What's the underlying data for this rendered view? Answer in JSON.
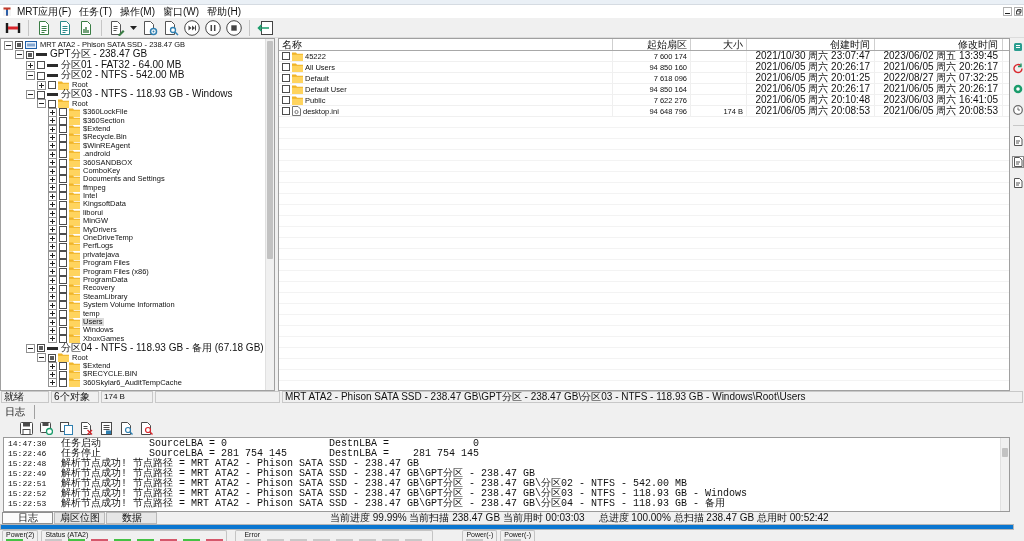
{
  "menu_bar": {
    "items": [
      "MRT应用(F)",
      "任务(T)",
      "操作(M)",
      "窗口(W)",
      "帮助(H)"
    ]
  },
  "tree": {
    "items": [
      {
        "label": "MRT ATA2 - Phison SATA SSD - 238.47 GB",
        "kind": "disk",
        "expanded": true,
        "partial": true,
        "selected": false,
        "children": [
          {
            "label": "GPT分区 - 238.47 GB",
            "kind": "partition",
            "expanded": true,
            "partial": true,
            "selected": false,
            "children": [
              {
                "label": "分区01 - FAT32 - 64.00 MB",
                "kind": "partition",
                "expanded": false,
                "partial": false,
                "selected": false
              },
              {
                "label": "分区02 - NTFS - 542.00 MB",
                "kind": "partition",
                "expanded": true,
                "partial": false,
                "selected": false,
                "children": [
                  {
                    "label": "Root",
                    "kind": "folder",
                    "expanded": false,
                    "partial": false,
                    "selected": false
                  }
                ]
              },
              {
                "label": "分区03 - NTFS - 118.93 GB - Windows",
                "kind": "partition",
                "expanded": true,
                "partial": false,
                "selected": false,
                "children": [
                  {
                    "label": "Root",
                    "kind": "folder",
                    "expanded": true,
                    "partial": false,
                    "selected": false,
                    "children": [
                      {
                        "label": "$360LockFile",
                        "kind": "folder",
                        "expanded": false,
                        "partial": false,
                        "selected": false
                      },
                      {
                        "label": "$360Section",
                        "kind": "folder",
                        "expanded": false,
                        "partial": false,
                        "selected": false
                      },
                      {
                        "label": "$Extend",
                        "kind": "folder",
                        "expanded": false,
                        "partial": false,
                        "selected": false
                      },
                      {
                        "label": "$Recycle.Bin",
                        "kind": "folder",
                        "expanded": false,
                        "partial": false,
                        "selected": false
                      },
                      {
                        "label": "$WinREAgent",
                        "kind": "folder",
                        "expanded": false,
                        "partial": false,
                        "selected": false
                      },
                      {
                        "label": ".android",
                        "kind": "folder",
                        "expanded": false,
                        "partial": false,
                        "selected": false
                      },
                      {
                        "label": "360SANDBOX",
                        "kind": "folder",
                        "expanded": false,
                        "partial": false,
                        "selected": false
                      },
                      {
                        "label": "ComboKey",
                        "kind": "folder",
                        "expanded": false,
                        "partial": false,
                        "selected": false
                      },
                      {
                        "label": "Documents and Settings",
                        "kind": "folder",
                        "expanded": false,
                        "partial": false,
                        "selected": false
                      },
                      {
                        "label": "ffmpeg",
                        "kind": "folder",
                        "expanded": false,
                        "partial": false,
                        "selected": false
                      },
                      {
                        "label": "Intel",
                        "kind": "folder",
                        "expanded": false,
                        "partial": false,
                        "selected": false
                      },
                      {
                        "label": "KingsoftData",
                        "kind": "folder",
                        "expanded": false,
                        "partial": false,
                        "selected": false
                      },
                      {
                        "label": "liborui",
                        "kind": "folder",
                        "expanded": false,
                        "partial": false,
                        "selected": false
                      },
                      {
                        "label": "MinGW",
                        "kind": "folder",
                        "expanded": false,
                        "partial": false,
                        "selected": false
                      },
                      {
                        "label": "MyDrivers",
                        "kind": "folder",
                        "expanded": false,
                        "partial": false,
                        "selected": false
                      },
                      {
                        "label": "OneDriveTemp",
                        "kind": "folder",
                        "expanded": false,
                        "partial": false,
                        "selected": false
                      },
                      {
                        "label": "PerfLogs",
                        "kind": "folder",
                        "expanded": false,
                        "partial": false,
                        "selected": false
                      },
                      {
                        "label": "privatejava",
                        "kind": "folder",
                        "expanded": false,
                        "partial": false,
                        "selected": false
                      },
                      {
                        "label": "Program Files",
                        "kind": "folder",
                        "expanded": false,
                        "partial": false,
                        "selected": false
                      },
                      {
                        "label": "Program Files (x86)",
                        "kind": "folder",
                        "expanded": false,
                        "partial": false,
                        "selected": false
                      },
                      {
                        "label": "ProgramData",
                        "kind": "folder",
                        "expanded": false,
                        "partial": false,
                        "selected": false
                      },
                      {
                        "label": "Recovery",
                        "kind": "folder",
                        "expanded": false,
                        "partial": false,
                        "selected": false
                      },
                      {
                        "label": "SteamLibrary",
                        "kind": "folder",
                        "expanded": false,
                        "partial": false,
                        "selected": false
                      },
                      {
                        "label": "System Volume Information",
                        "kind": "folder",
                        "expanded": false,
                        "partial": false,
                        "selected": false
                      },
                      {
                        "label": "temp",
                        "kind": "folder",
                        "expanded": false,
                        "partial": false,
                        "selected": false
                      },
                      {
                        "label": "Users",
                        "kind": "folder",
                        "expanded": false,
                        "partial": false,
                        "selected": true
                      },
                      {
                        "label": "Windows",
                        "kind": "folder",
                        "expanded": false,
                        "partial": false,
                        "selected": false
                      },
                      {
                        "label": "XboxGames",
                        "kind": "folder",
                        "expanded": false,
                        "partial": false,
                        "selected": false
                      }
                    ]
                  }
                ]
              },
              {
                "label": "分区04 - NTFS - 118.93 GB - 备用 (67.18 GB)",
                "kind": "partition",
                "expanded": true,
                "partial": true,
                "selected": false,
                "children": [
                  {
                    "label": "Root",
                    "kind": "folder",
                    "expanded": true,
                    "partial": true,
                    "selected": false,
                    "children": [
                      {
                        "label": "$Extend",
                        "kind": "folder",
                        "expanded": false,
                        "partial": false,
                        "selected": false
                      },
                      {
                        "label": "$RECYCLE.BIN",
                        "kind": "folder",
                        "expanded": false,
                        "partial": false,
                        "selected": false
                      },
                      {
                        "label": "360Skylar6_AuditTempCache",
                        "kind": "folder",
                        "expanded": false,
                        "partial": false,
                        "selected": false
                      }
                    ]
                  }
                ]
              }
            ]
          }
        ]
      }
    ]
  },
  "file_list": {
    "columns": [
      "名称",
      "起始扇区",
      "大小",
      "创建时间",
      "修改时间"
    ],
    "rows": [
      {
        "name": "45222",
        "kind": "folder",
        "checked": false,
        "selected": false,
        "start_sector": "7 600 174",
        "created": "2021/10/30 周六 23:07:47",
        "modified": "2023/06/02 周五 13:39:45"
      },
      {
        "name": "All Users",
        "kind": "folder",
        "checked": false,
        "selected": false,
        "start_sector": "94 850 160",
        "created": "2021/06/05 周六 20:26:17",
        "modified": "2021/06/05 周六 20:26:17"
      },
      {
        "name": "Default",
        "kind": "folder",
        "checked": false,
        "selected": false,
        "start_sector": "7 618 096",
        "created": "2021/06/05 周六 20:01:25",
        "modified": "2022/08/27 周六 07:32:25"
      },
      {
        "name": "Default User",
        "kind": "folder",
        "checked": false,
        "selected": false,
        "start_sector": "94 850 164",
        "created": "2021/06/05 周六 20:26:17",
        "modified": "2021/06/05 周六 20:26:17"
      },
      {
        "name": "Public",
        "kind": "folder",
        "checked": false,
        "selected": false,
        "start_sector": "7 622 276",
        "created": "2021/06/05 周六 20:10:48",
        "modified": "2023/06/03 周六 16:41:05"
      },
      {
        "name": "desktop.ini",
        "kind": "file",
        "checked": false,
        "selected": false,
        "start_sector": "94 648 796",
        "size": "174 B",
        "created": "2021/06/05 周六 20:08:53",
        "modified": "2021/06/05 周六 20:08:53"
      }
    ]
  },
  "side_toolbar": {
    "items": [
      {
        "kind": "tile",
        "selected": false
      },
      {
        "kind": "arrows",
        "selected": false
      },
      {
        "kind": "circle",
        "selected": false
      },
      {
        "kind": "clock",
        "selected": false
      },
      {
        "kind": "document",
        "selected": false
      },
      {
        "kind": "document",
        "selected": true
      },
      {
        "kind": "document",
        "selected": false
      }
    ]
  },
  "status_bar": {
    "state": "就绪",
    "object_count": "6个对象",
    "size": "174 B",
    "path": "MRT ATA2 - Phison SATA SSD - 238.47 GB\\GPT分区 - 238.47 GB\\分区03 - NTFS - 118.93 GB - Windows\\Root\\Users"
  },
  "log_panel": {
    "title": "日志",
    "entries": [
      {
        "time": "14:47:30",
        "message": "任务启动        SourceLBA = 0                 DestnLBA =              0"
      },
      {
        "time": "15:22:46",
        "message": "任务停止        SourceLBA = 281 754 145       DestnLBA =    281 754 145"
      },
      {
        "time": "15:22:48",
        "message": "解析节点成功! 节点路径 = MRT ATA2 - Phison SATA SSD - 238.47 GB"
      },
      {
        "time": "15:22:49",
        "message": "解析节点成功! 节点路径 = MRT ATA2 - Phison SATA SSD - 238.47 GB\\GPT分区 - 238.47 GB"
      },
      {
        "time": "15:22:51",
        "message": "解析节点成功! 节点路径 = MRT ATA2 - Phison SATA SSD - 238.47 GB\\GPT分区 - 238.47 GB\\分区02 - NTFS - 542.00 MB"
      },
      {
        "time": "15:22:52",
        "message": "解析节点成功! 节点路径 = MRT ATA2 - Phison SATA SSD - 238.47 GB\\GPT分区 - 238.47 GB\\分区03 - NTFS - 118.93 GB - Windows"
      },
      {
        "time": "15:22:53",
        "message": "解析节点成功! 节点路径 = MRT ATA2 - Phison SATA SSD - 238.47 GB\\GPT分区 - 238.47 GB\\分区04 - NTFS - 118.93 GB - 备用"
      }
    ]
  },
  "bottom_tabs": [
    {
      "label": "日志",
      "selected": true
    },
    {
      "label": "扇区位图",
      "selected": false
    },
    {
      "label": "数据",
      "selected": false
    }
  ],
  "progress": {
    "current": "当前进度 99.99% 当前扫描 238.47 GB 当前用时 00:03:03",
    "total": "总进度 100.00% 总扫描 238.47 GB 总用时 00:52:42",
    "level": 1
  },
  "indicators": [
    {
      "label": "Power(2)",
      "lights": [
        {
          "color": "#44c144"
        }
      ]
    },
    {
      "label": "Status (ATA2)",
      "lights": [
        {
          "color": "#c8c8c8"
        },
        {
          "color": "#44c144"
        },
        {
          "color": "#d5576b"
        },
        {
          "color": "#44c144"
        },
        {
          "color": "#44c144"
        },
        {
          "color": "#d5576b"
        },
        {
          "color": "#44c144"
        },
        {
          "color": "#d5576b"
        }
      ]
    },
    {
      "label": "Error",
      "lights": [
        {
          "color": "#c8c8c8"
        },
        {
          "color": "#c8c8c8"
        },
        {
          "color": "#c8c8c8"
        },
        {
          "color": "#c8c8c8"
        },
        {
          "color": "#c8c8c8"
        },
        {
          "color": "#c8c8c8"
        },
        {
          "color": "#c8c8c8"
        },
        {
          "color": "#c8c8c8"
        }
      ]
    },
    {
      "label": "Power(-)",
      "lights": [
        {
          "color": "#c8c8c8"
        }
      ]
    },
    {
      "label": "Power(-)",
      "lights": [
        {
          "color": "#c8c8c8"
        }
      ]
    }
  ]
}
